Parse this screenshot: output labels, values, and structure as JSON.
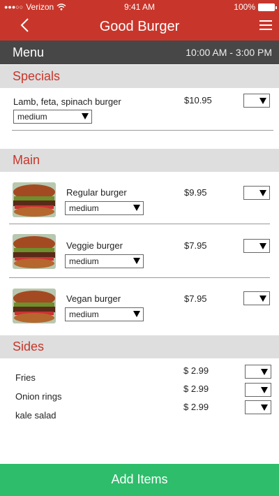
{
  "status_bar": {
    "carrier": "Verizon",
    "time": "9:41 AM",
    "battery": "100%"
  },
  "nav": {
    "title": "Good Burger"
  },
  "menu_bar": {
    "label": "Menu",
    "hours": "10:00 AM - 3:00 PM"
  },
  "sections": {
    "specials": {
      "title": "Specials",
      "items": [
        {
          "name": "Lamb, feta, spinach burger",
          "price": "$10.95",
          "doneness": "medium"
        }
      ]
    },
    "main": {
      "title": "Main",
      "items": [
        {
          "name": "Regular burger",
          "price": "$9.95",
          "doneness": "medium"
        },
        {
          "name": "Veggie burger",
          "price": "$7.95",
          "doneness": "medium"
        },
        {
          "name": "Vegan burger",
          "price": "$7.95",
          "doneness": "medium"
        }
      ]
    },
    "sides": {
      "title": "Sides",
      "items": [
        {
          "name": "Fries",
          "price": "$ 2.99"
        },
        {
          "name": "Onion rings",
          "price": "$ 2.99"
        },
        {
          "name": "kale salad",
          "price": "$ 2.99"
        }
      ]
    }
  },
  "footer": {
    "add_label": "Add Items"
  },
  "colors": {
    "brand": "#c8362b",
    "menubar": "#474747",
    "section_bg": "#dedede",
    "add_button": "#2ebd6b"
  }
}
